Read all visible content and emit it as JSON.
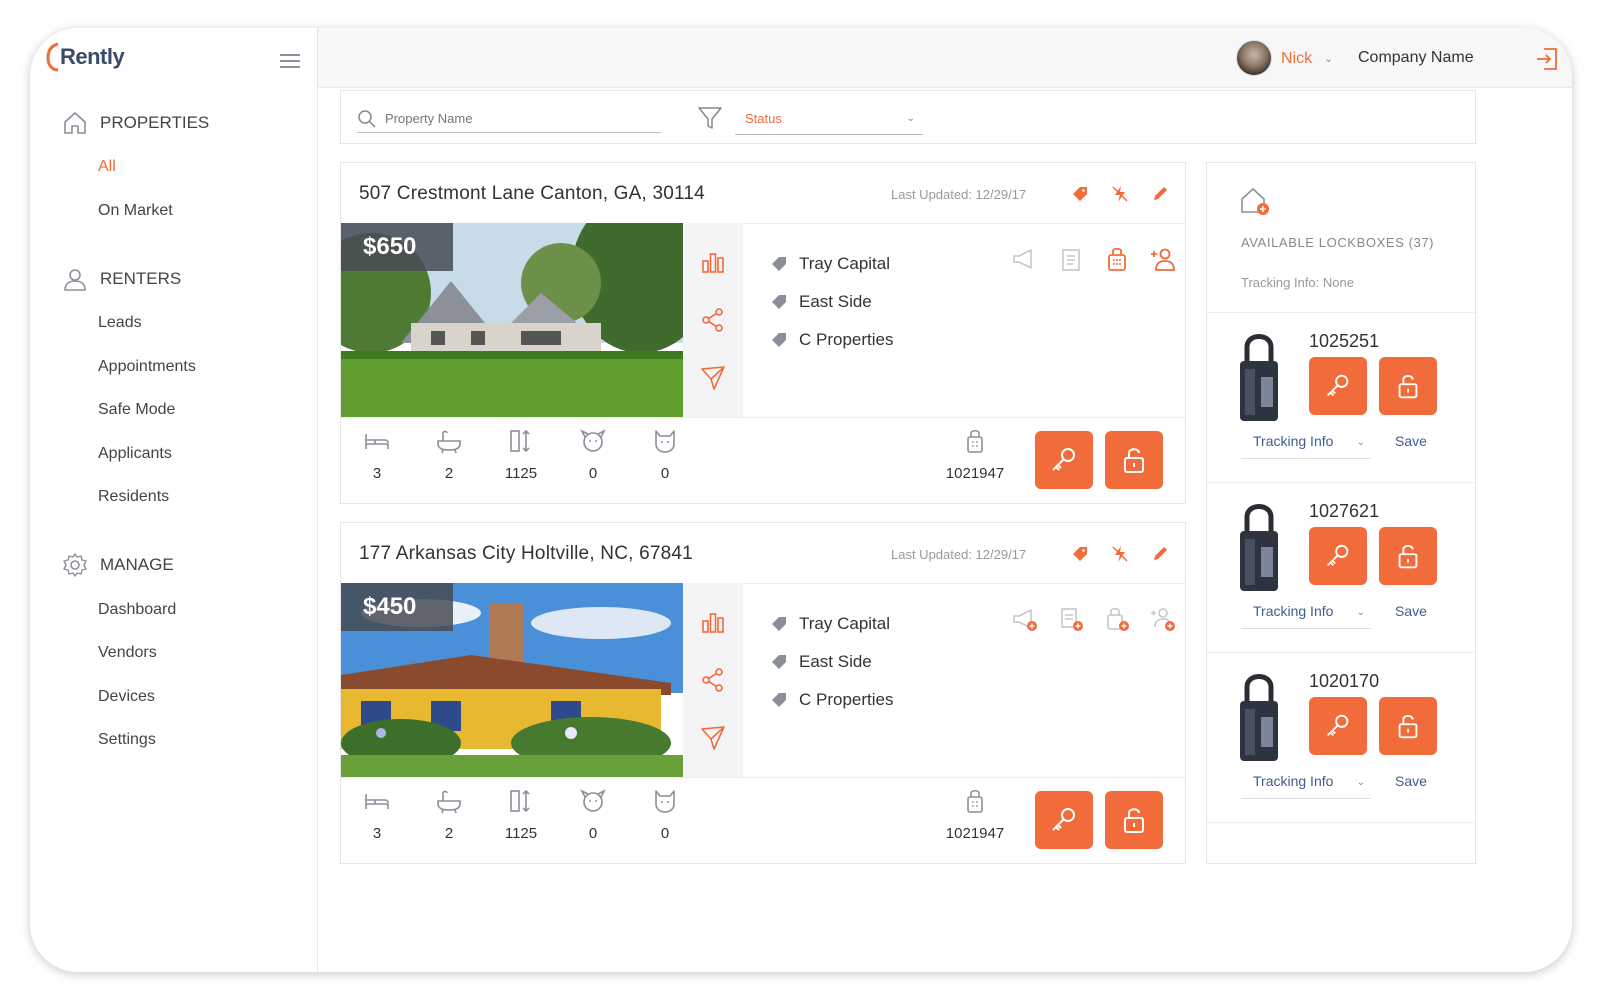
{
  "brand": {
    "name": "Rently",
    "accent": "#f26b3a",
    "link": "#3f5c8f"
  },
  "header": {
    "user": "Nick",
    "company": "Company Name"
  },
  "sidebar": {
    "sections": [
      {
        "label": "PROPERTIES",
        "icon": "home-icon",
        "items": [
          "All",
          "On Market"
        ]
      },
      {
        "label": "RENTERS",
        "icon": "user-icon",
        "items": [
          "Leads",
          "Appointments",
          "Safe Mode",
          "Applicants",
          "Residents"
        ]
      },
      {
        "label": "MANAGE",
        "icon": "gear-icon",
        "items": [
          "Dashboard",
          "Vendors",
          "Devices",
          "Settings"
        ]
      }
    ],
    "active_item": "All"
  },
  "filters": {
    "search_placeholder": "Property Name",
    "status_label": "Status"
  },
  "properties": [
    {
      "address": "507 Crestmont Lane Canton, GA, 30114",
      "updated": "Last Updated: 12/29/17",
      "price": "$650",
      "tags": [
        "Tray Capital",
        "East Side",
        "C Properties"
      ],
      "stats": [
        "3",
        "2",
        "1125",
        "0",
        "0"
      ],
      "lockbox": "1021947"
    },
    {
      "address": "177 Arkansas City Holtville, NC, 67841",
      "updated": "Last Updated: 12/29/17",
      "price": "$450",
      "tags": [
        "Tray Capital",
        "East Side",
        "C Properties"
      ],
      "stats": [
        "3",
        "2",
        "1125",
        "0",
        "0"
      ],
      "lockbox": "1021947"
    }
  ],
  "lockbox_panel": {
    "title": "AVAILABLE LOCKBOXES (37)",
    "tracking_info": "Tracking Info: None",
    "lockboxes": [
      {
        "id": "1025251",
        "tracking": "Tracking Info",
        "save": "Save"
      },
      {
        "id": "1027621",
        "tracking": "Tracking Info",
        "save": "Save"
      },
      {
        "id": "1020170",
        "tracking": "Tracking Info",
        "save": "Save"
      }
    ]
  }
}
